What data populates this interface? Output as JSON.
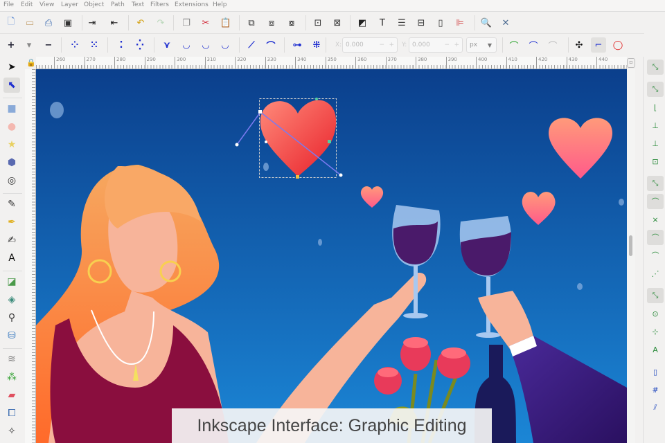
{
  "menu": [
    "File",
    "Edit",
    "View",
    "Layer",
    "Object",
    "Path",
    "Text",
    "Filters",
    "Extensions",
    "Help"
  ],
  "toolbar1": [
    {
      "icon": "new-document-icon",
      "g": "🗋",
      "c": "#4a7fd0"
    },
    {
      "icon": "open-icon",
      "g": "▭",
      "c": "#c8a878"
    },
    {
      "icon": "print-icon",
      "g": "⎙",
      "c": "#3a6ab0"
    },
    {
      "icon": "save-icon",
      "g": "▣",
      "c": "#333"
    },
    {
      "icon": "import-icon",
      "g": "⇥",
      "c": "#222"
    },
    {
      "icon": "export-icon",
      "g": "⇤",
      "c": "#222"
    },
    {
      "icon": "undo-icon",
      "g": "↶",
      "c": "#d4a010"
    },
    {
      "icon": "redo-icon",
      "g": "↷",
      "c": "#bcd8bc"
    },
    {
      "icon": "copy-icon",
      "g": "❐",
      "c": "#888"
    },
    {
      "icon": "cut-icon",
      "g": "✂",
      "c": "#d02030"
    },
    {
      "icon": "paste-icon",
      "g": "📋",
      "c": "#c89040"
    },
    {
      "icon": "duplicate-icon",
      "g": "⧉",
      "c": "#333"
    },
    {
      "icon": "clone-icon",
      "g": "⧈",
      "c": "#333"
    },
    {
      "icon": "unlink-clone-icon",
      "g": "⧇",
      "c": "#333"
    },
    {
      "icon": "zoom-selection-icon",
      "g": "⊡",
      "c": "#333"
    },
    {
      "icon": "zoom-drawing-icon",
      "g": "⊠",
      "c": "#333"
    },
    {
      "icon": "fill-stroke-icon",
      "g": "◩",
      "c": "#222"
    },
    {
      "icon": "text-font-icon",
      "g": "T",
      "c": "#222"
    },
    {
      "icon": "layers-icon",
      "g": "☰",
      "c": "#444"
    },
    {
      "icon": "xml-editor-icon",
      "g": "⊟",
      "c": "#333"
    },
    {
      "icon": "objects-icon",
      "g": "▯",
      "c": "#333"
    },
    {
      "icon": "align-icon",
      "g": "⊫",
      "c": "#d04040"
    },
    {
      "icon": "document-properties-icon",
      "g": "🔍",
      "c": "#aaa"
    },
    {
      "icon": "preferences-icon",
      "g": "✕",
      "c": "#4a6a90"
    }
  ],
  "toolbar2": [
    {
      "icon": "insert-node-icon",
      "g": "+",
      "c": "#223"
    },
    {
      "icon": "insert-node-dropdown-icon",
      "g": "▾",
      "c": "#888"
    },
    {
      "icon": "delete-node-icon",
      "g": "−",
      "c": "#223"
    },
    {
      "icon": "join-nodes-icon",
      "g": "⁘",
      "c": "#2030d0"
    },
    {
      "icon": "break-path-icon",
      "g": "⁙",
      "c": "#2030d0"
    },
    {
      "icon": "join-segment-icon",
      "g": "⁚",
      "c": "#2030d0"
    },
    {
      "icon": "delete-segment-icon",
      "g": "⁛",
      "c": "#2030d0"
    },
    {
      "icon": "node-cusp-icon",
      "g": "⋎",
      "c": "#2030d0"
    },
    {
      "icon": "node-smooth-icon",
      "g": "◡",
      "c": "#2030d0"
    },
    {
      "icon": "node-symmetric-icon",
      "g": "◡",
      "c": "#2030d0"
    },
    {
      "icon": "node-auto-icon",
      "g": "◡",
      "c": "#2030d0"
    },
    {
      "icon": "segment-line-icon",
      "g": "⟋",
      "c": "#2030d0"
    },
    {
      "icon": "segment-curve-icon",
      "g": "⌒",
      "c": "#2030d0"
    },
    {
      "icon": "object-to-path-icon",
      "g": "⊶",
      "c": "#2030d0"
    },
    {
      "icon": "stroke-to-path-icon",
      "g": "⁜",
      "c": "#2030d0"
    }
  ],
  "coords": {
    "x_label": "X:",
    "x_value": "0.000",
    "y_label": "Y:",
    "y_value": "0.000",
    "unit": "px",
    "minus": "−",
    "plus": "+"
  },
  "toolbar2_right": [
    {
      "icon": "next-path-effect-param-icon",
      "g": "⌒",
      "c": "#20a020"
    },
    {
      "icon": "edit-clip-icon",
      "g": "⌒",
      "c": "#2030d0"
    },
    {
      "icon": "edit-mask-icon",
      "g": "⌒",
      "c": "#bbb"
    },
    {
      "icon": "show-transform-handles-icon",
      "g": "✣",
      "c": "#111"
    },
    {
      "icon": "show-handles-icon",
      "g": "⌐",
      "c": "#2030d0",
      "on": true
    },
    {
      "icon": "show-path-outline-icon",
      "g": "◯",
      "c": "#e02020"
    }
  ],
  "ruler_labels": [
    "260",
    "270",
    "280",
    "290",
    "300",
    "310",
    "320",
    "330",
    "340",
    "350",
    "360",
    "370",
    "380",
    "390",
    "400",
    "410",
    "420",
    "430",
    "440"
  ],
  "tools": [
    {
      "icon": "selector-tool-icon",
      "g": "➤",
      "c": "#111"
    },
    {
      "icon": "node-tool-icon",
      "g": "⬉",
      "c": "#2030d0",
      "on": true
    },
    {
      "icon": "rectangle-tool-icon",
      "g": "■",
      "c": "#8aaad8"
    },
    {
      "icon": "ellipse-tool-icon",
      "g": "●",
      "c": "#f4b8b0"
    },
    {
      "icon": "star-tool-icon",
      "g": "★",
      "c": "#e8d060"
    },
    {
      "icon": "3d-box-tool-icon",
      "g": "⬢",
      "c": "#5a6ab0"
    },
    {
      "icon": "spiral-tool-icon",
      "g": "◎",
      "c": "#333"
    },
    {
      "icon": "pencil-tool-icon",
      "g": "✎",
      "c": "#333"
    },
    {
      "icon": "pen-tool-icon",
      "g": "✒",
      "c": "#e0b020"
    },
    {
      "icon": "calligraphy-tool-icon",
      "g": "✍",
      "c": "#333"
    },
    {
      "icon": "text-tool-icon",
      "g": "A",
      "c": "#111"
    },
    {
      "icon": "gradient-tool-icon",
      "g": "◪",
      "c": "#4a9a4a"
    },
    {
      "icon": "mesh-tool-icon",
      "g": "◈",
      "c": "#3a8a7a"
    },
    {
      "icon": "dropper-tool-icon",
      "g": "⚲",
      "c": "#333"
    },
    {
      "icon": "paint-bucket-tool-icon",
      "g": "⛁",
      "c": "#3a7ac0"
    },
    {
      "icon": "tweak-tool-icon",
      "g": "≋",
      "c": "#777"
    },
    {
      "icon": "spray-tool-icon",
      "g": "⁂",
      "c": "#30a030"
    },
    {
      "icon": "eraser-tool-icon",
      "g": "▰",
      "c": "#e05060"
    },
    {
      "icon": "connector-tool-icon",
      "g": "⧠",
      "c": "#3a6ab0"
    },
    {
      "icon": "measure-tool-icon",
      "g": "✧",
      "c": "#444"
    }
  ],
  "snaps": [
    {
      "icon": "snap-enable-icon",
      "g": "⤡",
      "on": true
    },
    {
      "icon": "snap-bbox-icon",
      "g": "⤡",
      "on": true
    },
    {
      "icon": "snap-bbox-edge-icon",
      "g": "⌊"
    },
    {
      "icon": "snap-bbox-corner-icon",
      "g": "⊥"
    },
    {
      "icon": "snap-bbox-midpoint-icon",
      "g": "⊥"
    },
    {
      "icon": "snap-bbox-center-icon",
      "g": "⊡"
    },
    {
      "icon": "snap-nodes-icon",
      "g": "⤡",
      "on": true
    },
    {
      "icon": "snap-path-icon",
      "g": "⌒",
      "on": true
    },
    {
      "icon": "snap-intersection-icon",
      "g": "⨯"
    },
    {
      "icon": "snap-cusp-icon",
      "g": "⌒",
      "on": true
    },
    {
      "icon": "snap-smooth-icon",
      "g": "⌒"
    },
    {
      "icon": "snap-midpoint-icon",
      "g": "⋰"
    },
    {
      "icon": "snap-others-icon",
      "g": "⤡",
      "on": true
    },
    {
      "icon": "snap-center-icon",
      "g": "⊙"
    },
    {
      "icon": "snap-rotation-center-icon",
      "g": "⊹"
    },
    {
      "icon": "snap-text-baseline-icon",
      "g": "A"
    },
    {
      "icon": "snap-page-icon",
      "g": "▯"
    },
    {
      "icon": "snap-grid-icon",
      "g": "#"
    },
    {
      "icon": "snap-guide-icon",
      "g": "⫽"
    }
  ],
  "caption": "Inkscape Interface: Graphic Editing",
  "colors": {
    "canvas_top": "#0b3f8c",
    "canvas_bottom": "#1b86d6",
    "selection": "#5a5aee"
  }
}
